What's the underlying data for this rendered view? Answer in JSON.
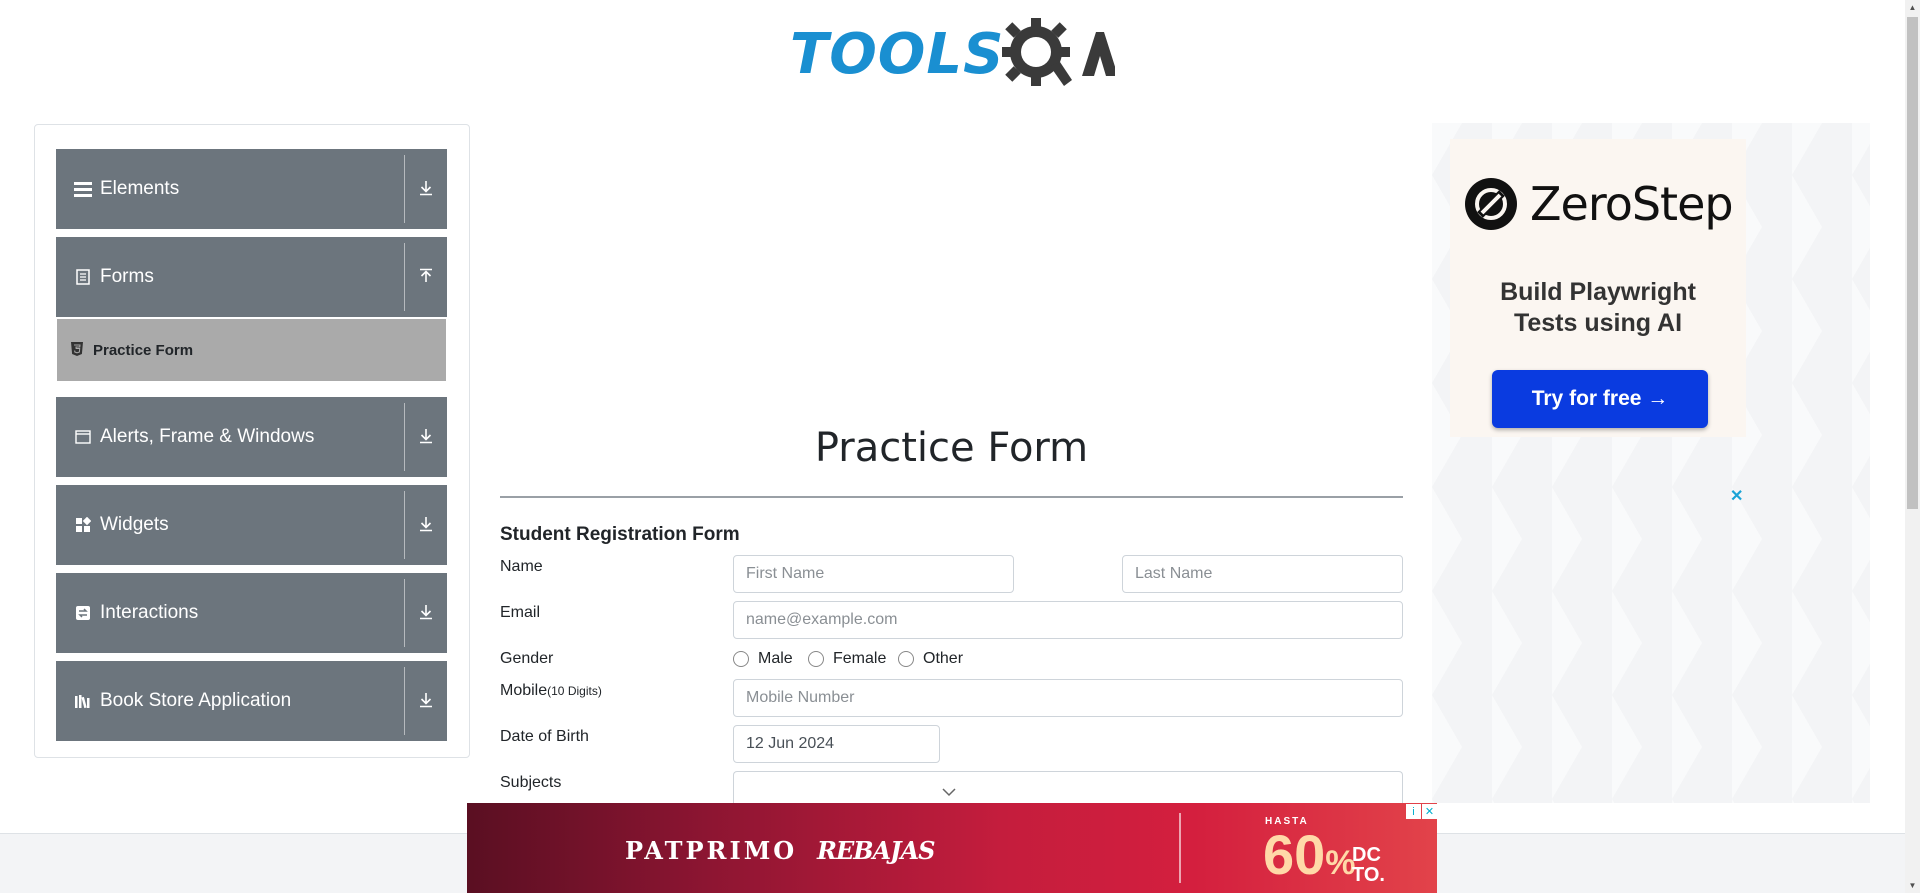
{
  "header": {
    "logo_text": "TOOLS",
    "logo_suffix": "QA"
  },
  "sidebar": {
    "groups": [
      {
        "label": "Elements",
        "icon": "hamburger-icon",
        "toggle": "download-arrow-icon"
      },
      {
        "label": "Forms",
        "icon": "document-icon",
        "toggle": "upload-arrow-icon"
      },
      {
        "label": "Alerts, Frame & Windows",
        "icon": "window-icon",
        "toggle": "download-arrow-icon"
      },
      {
        "label": "Widgets",
        "icon": "grid-icon",
        "toggle": "download-arrow-icon"
      },
      {
        "label": "Interactions",
        "icon": "interaction-icon",
        "toggle": "download-arrow-icon"
      },
      {
        "label": "Book Store Application",
        "icon": "books-icon",
        "toggle": "download-arrow-icon"
      }
    ],
    "active_item": {
      "label": "Practice Form",
      "icon": "html5-icon"
    }
  },
  "form": {
    "page_title": "Practice Form",
    "subtitle": "Student Registration Form",
    "name_label": "Name",
    "first_name_placeholder": "First Name",
    "last_name_placeholder": "Last Name",
    "email_label": "Email",
    "email_placeholder": "name@example.com",
    "gender_label": "Gender",
    "gender_options": [
      "Male",
      "Female",
      "Other"
    ],
    "mobile_label": "Mobile",
    "mobile_hint": "(10 Digits)",
    "mobile_placeholder": "Mobile Number",
    "dob_label": "Date of Birth",
    "dob_value": "12 Jun 2024",
    "subjects_label": "Subjects"
  },
  "ad_right": {
    "brand": "ZeroStep",
    "tagline_line1": "Build Playwright",
    "tagline_line2": "Tests using AI",
    "cta": "Try for free →",
    "close": "✕"
  },
  "banner": {
    "brand": "PATPRIMO",
    "sale": "REBAJAS",
    "hasta": "HASTA",
    "percent": "60",
    "percent_sign": "%",
    "dcto_line1": "DC",
    "dcto_line2": "TO.",
    "adchoice_info": "i",
    "adchoice_close": "✕"
  },
  "colors": {
    "sidebar_group": "#6c757d",
    "active_item": "#aaaaaa",
    "logo_blue": "#1a8fd1",
    "cta_blue": "#0a3be0"
  }
}
